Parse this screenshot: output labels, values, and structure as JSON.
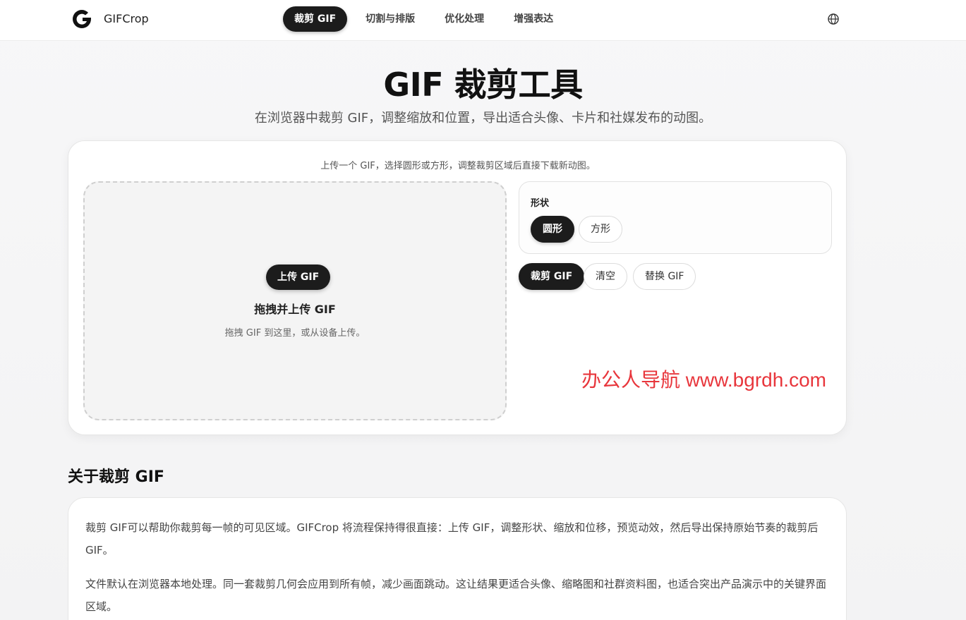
{
  "header": {
    "brand": "GIFCrop",
    "nav": [
      "裁剪 GIF",
      "切割与排版",
      "优化处理",
      "增强表达"
    ],
    "active_nav": 0,
    "logo_icon": "g-logo-icon",
    "language_icon": "globe-icon"
  },
  "hero": {
    "title": "GIF 裁剪工具",
    "subtitle": "在浏览器中裁剪 GIF，调整缩放和位置，导出适合头像、卡片和社媒发布的动图。"
  },
  "tool": {
    "hint": "上传一个 GIF，选择圆形或方形，调整裁剪区域后直接下载新动图。",
    "dropzone": {
      "upload_label": "上传 GIF",
      "title": "拖拽并上传 GIF",
      "description": "拖拽 GIF 到这里，或从设备上传。"
    },
    "shape": {
      "label": "形状",
      "options": [
        "圆形",
        "方形"
      ],
      "selected": "圆形"
    },
    "actions": {
      "crop": "裁剪 GIF",
      "clear": "清空",
      "replace": "替换 GIF"
    }
  },
  "watermark": "办公人导航 www.bgrdh.com",
  "about": {
    "title": "关于裁剪 GIF",
    "paragraphs": [
      "裁剪 GIF可以帮助你裁剪每一帧的可见区域。GIFCrop 将流程保持得很直接：上传 GIF，调整形状、缩放和位移，预览动效，然后导出保持原始节奏的裁剪后 GIF。",
      "文件默认在浏览器本地处理。同一套裁剪几何会应用到所有帧，减少画面跳动。这让结果更适合头像、缩略图和社群资料图，也适合突出产品演示中的关键界面区域。"
    ]
  },
  "colors": {
    "primary": "#1c1c1c",
    "watermark": "#e8363c",
    "background": "#f5f5f6"
  }
}
